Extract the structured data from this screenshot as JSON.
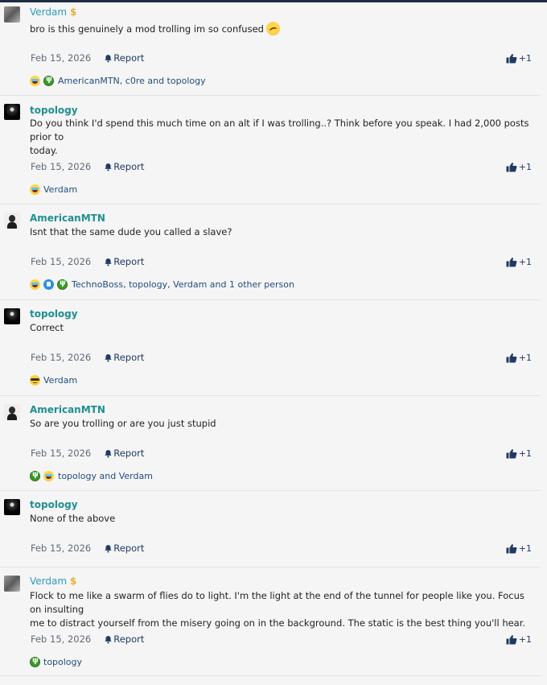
{
  "report_label": "Report",
  "like_count": "+1",
  "posts": [
    {
      "username": "Verdam",
      "body": [
        "bro is this genuinely a mod trolling im so confused"
      ],
      "date": "Feb 15, 2026",
      "reactions_text": "AmericanMTN, c0re and topology",
      "reaction_icons": [
        "laugh-emoji",
        "green-emoji"
      ]
    },
    {
      "username": "topology",
      "body": [
        "Do you think I'd spend this much time on an alt if I was trolling..? Think before you speak. I had 2,000 posts prior to",
        "today."
      ],
      "date": "Feb 15, 2026",
      "reactions_text": "Verdam",
      "reaction_icons": [
        "laugh-emoji"
      ]
    },
    {
      "username": "AmericanMTN",
      "body": [
        "Isnt that the same dude you called a slave?"
      ],
      "date": "Feb 15, 2026",
      "reactions_text": "TechnoBoss, topology, Verdam and 1 other person",
      "reaction_icons": [
        "laugh-emoji",
        "blue-emoji",
        "green-emoji"
      ]
    },
    {
      "username": "topology",
      "body": [
        "Correct"
      ],
      "date": "Feb 15, 2026",
      "reactions_text": "Verdam",
      "reaction_icons": [
        "sunglasses-emoji"
      ]
    },
    {
      "username": "AmericanMTN",
      "body": [
        "So are you trolling or are you just stupid"
      ],
      "date": "Feb 15, 2026",
      "reactions_text": "topology and Verdam",
      "reaction_icons": [
        "green-emoji",
        "laugh-emoji"
      ]
    },
    {
      "username": "topology",
      "body": [
        "None of the above"
      ],
      "date": "Feb 15, 2026",
      "reactions_text": "",
      "reaction_icons": []
    },
    {
      "username": "Verdam",
      "body": [
        "Flock to me like a swarm of flies do to light. I'm the light at the end of the tunnel for people like you. Focus on insulting",
        "me to distract yourself from the misery going on in the background. The static is the best thing you'll hear."
      ],
      "date": "Feb 15, 2026",
      "reactions_text": "topology",
      "reaction_icons": [
        "green-emoji"
      ]
    }
  ],
  "colors": {
    "username_teal": "#1f8f8f",
    "username_blue": "#2a9bbd",
    "link_navy": "#1f3a63",
    "header_bar": "#1f2c44"
  }
}
